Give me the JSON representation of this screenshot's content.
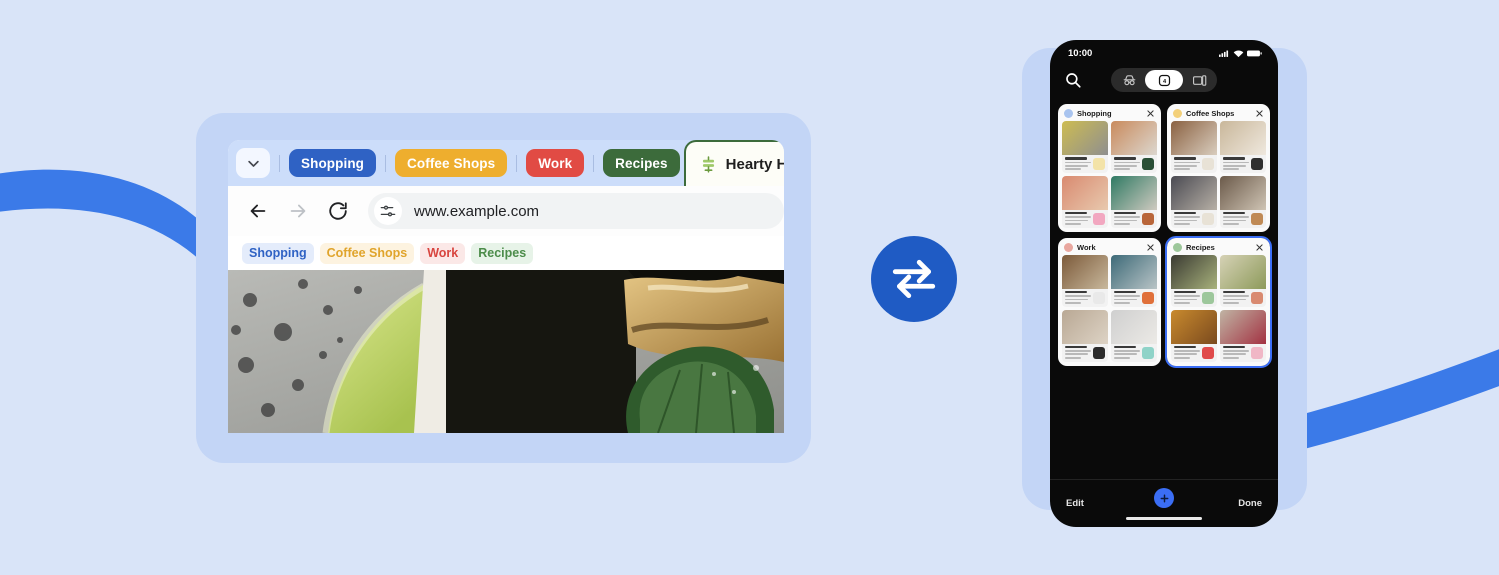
{
  "theme": {
    "background": "#d9e4f8",
    "panel": "#c3d5f6",
    "ribbon": "#3b7ae8",
    "accent_blue": "#1f5bc4",
    "selection_blue": "#3b6ef5"
  },
  "desktop": {
    "tabstrip": {
      "chevron_icon": "chevron-down-icon",
      "groups": [
        {
          "label": "Shopping",
          "color": "#2f62c4",
          "text": "#ffffff"
        },
        {
          "label": "Coffee Shops",
          "color": "#eeae2e",
          "text": "#ffffff"
        },
        {
          "label": "Work",
          "color": "#e14b44",
          "text": "#ffffff"
        },
        {
          "label": "Recipes",
          "color": "#3c6b3b",
          "text": "#ffffff"
        }
      ],
      "active_tab": {
        "title": "Hearty Herb",
        "favicon": "herb-plant-icon"
      }
    },
    "toolbar": {
      "back_icon": "back-arrow-icon",
      "forward_icon": "forward-arrow-icon",
      "reload_icon": "reload-icon",
      "site_settings_icon": "tune-sliders-icon",
      "url": "www.example.com"
    },
    "bookmarks": [
      {
        "label": "Shopping",
        "bg": "#e4ecfb",
        "text": "#2f62c4"
      },
      {
        "label": "Coffee Shops",
        "bg": "#fdf3e0",
        "text": "#e0a42b"
      },
      {
        "label": "Work",
        "bg": "#fbe8e7",
        "text": "#d8453f"
      },
      {
        "label": "Recipes",
        "bg": "#e7f3e8",
        "text": "#4c8c4a"
      }
    ],
    "hero_photo_alt": "close-up food photo with lime wedge and herb leaf"
  },
  "sync": {
    "icon": "sync-arrows-icon"
  },
  "phone": {
    "status": {
      "time": "10:00",
      "signal_icon": "cellular-signal-icon",
      "wifi_icon": "wifi-icon",
      "battery_icon": "battery-icon"
    },
    "top": {
      "search_icon": "search-icon",
      "segments": [
        {
          "icon": "incognito-icon",
          "selected": false,
          "label": ""
        },
        {
          "icon": "tab-count-icon",
          "selected": true,
          "label": "4"
        },
        {
          "icon": "other-devices-icon",
          "selected": false,
          "label": ""
        }
      ]
    },
    "tab_groups": [
      {
        "name": "Shopping",
        "dot": "#a9c4ef",
        "selected": false,
        "close_icon": "close-icon",
        "tiles": [
          {
            "favicon": "#f3e3a8",
            "thumb": [
              "#cdbc52",
              "#8f8f8f"
            ]
          },
          {
            "favicon": "#2a4f36",
            "thumb": [
              "#c98a5c",
              "#dcd7cf"
            ]
          },
          {
            "favicon": "#f2a7c0",
            "thumb": [
              "#d98a70",
              "#e8c9ae"
            ]
          },
          {
            "favicon": "#b9663a",
            "thumb": [
              "#2f7a63",
              "#cfcac0"
            ]
          }
        ]
      },
      {
        "name": "Coffee Shops",
        "dot": "#f3d07a",
        "selected": false,
        "close_icon": "close-icon",
        "tiles": [
          {
            "favicon": "#e8e2d6",
            "thumb": [
              "#8a6141",
              "#d9cdbe"
            ]
          },
          {
            "favicon": "#2f2f2f",
            "thumb": [
              "#c9b79a",
              "#efe8de"
            ]
          },
          {
            "favicon": "#e8e2d6",
            "thumb": [
              "#4a4a52",
              "#b7b0a6"
            ]
          },
          {
            "favicon": "#c08a55",
            "thumb": [
              "#6b5a4a",
              "#cfc4b4"
            ]
          }
        ]
      },
      {
        "name": "Work",
        "dot": "#e9a79f",
        "selected": false,
        "close_icon": "close-icon",
        "tiles": [
          {
            "favicon": "#e9e9e9",
            "thumb": [
              "#7c5a3a",
              "#c8b89c"
            ]
          },
          {
            "favicon": "#e0703a",
            "thumb": [
              "#3d6a78",
              "#b9c4c6"
            ]
          },
          {
            "favicon": "#2b2b2b",
            "thumb": [
              "#b9a894",
              "#ddd3c5"
            ]
          },
          {
            "favicon": "#8fd3c8",
            "thumb": [
              "#cfcfcf",
              "#eceae6"
            ]
          }
        ]
      },
      {
        "name": "Recipes",
        "dot": "#9dc79b",
        "selected": true,
        "close_icon": "close-icon",
        "tiles": [
          {
            "favicon": "#9dc79b",
            "thumb": [
              "#3a3a32",
              "#a8b27c"
            ]
          },
          {
            "favicon": "#d98a70",
            "thumb": [
              "#d6d2b6",
              "#8d9a5a"
            ]
          },
          {
            "favicon": "#e04b4b",
            "thumb": [
              "#c98a2e",
              "#7a4a1e"
            ]
          },
          {
            "favicon": "#f0b7c6",
            "thumb": [
              "#c0b4a4",
              "#a33242"
            ]
          }
        ]
      }
    ],
    "bottom": {
      "edit_label": "Edit",
      "done_label": "Done",
      "add_icon": "plus-icon"
    }
  }
}
